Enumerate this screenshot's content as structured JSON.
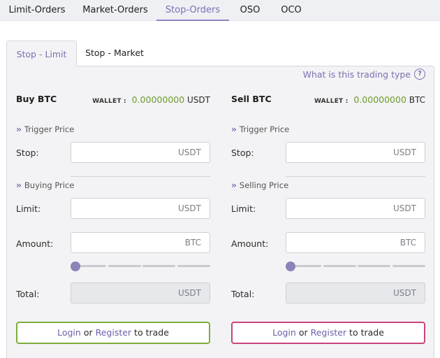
{
  "top_tabs": [
    {
      "label": "Limit-Orders",
      "active": false
    },
    {
      "label": "Market-Orders",
      "active": false
    },
    {
      "label": "Stop-Orders",
      "active": true
    },
    {
      "label": "OSO",
      "active": false
    },
    {
      "label": "OCO",
      "active": false
    }
  ],
  "sub_tabs": [
    {
      "label": "Stop - Limit",
      "active": true
    },
    {
      "label": "Stop - Market",
      "active": false
    }
  ],
  "help_link": "What is this trading type",
  "help_icon": "question-circle-icon",
  "buy": {
    "title": "Buy BTC",
    "wallet_label": "WALLET :",
    "wallet_value": "0.00000000",
    "wallet_currency": "USDT",
    "trigger_section": "Trigger Price",
    "stop_label": "Stop:",
    "stop_unit": "USDT",
    "price_section": "Buying Price",
    "limit_label": "Limit:",
    "limit_unit": "USDT",
    "amount_label": "Amount:",
    "amount_unit": "BTC",
    "total_label": "Total:",
    "total_unit": "USDT",
    "btn_login": "Login",
    "btn_or": "or",
    "btn_register": "Register",
    "btn_suffix": "to trade"
  },
  "sell": {
    "title": "Sell BTC",
    "wallet_label": "WALLET :",
    "wallet_value": "0.00000000",
    "wallet_currency": "BTC",
    "trigger_section": "Trigger Price",
    "stop_label": "Stop:",
    "stop_unit": "USDT",
    "price_section": "Selling Price",
    "limit_label": "Limit:",
    "limit_unit": "USDT",
    "amount_label": "Amount:",
    "amount_unit": "BTC",
    "total_label": "Total:",
    "total_unit": "USDT",
    "btn_login": "Login",
    "btn_or": "or",
    "btn_register": "Register",
    "btn_suffix": "to trade"
  },
  "colors": {
    "accent": "#7a70b1",
    "wallet_value": "#6b9a2b",
    "buy_border": "#7fae3a",
    "sell_border": "#c8447e"
  }
}
